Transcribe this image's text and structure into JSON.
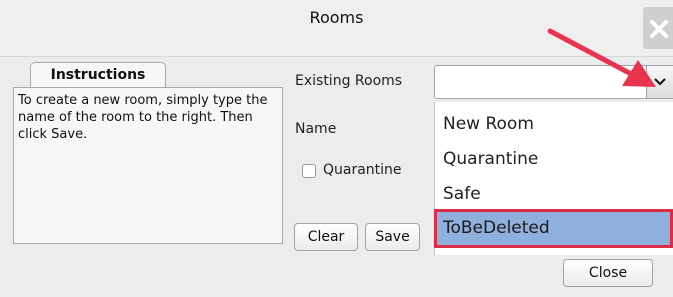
{
  "window": {
    "title": "Rooms"
  },
  "instructions": {
    "tab_label": "Instructions",
    "text": "To create a new room, simply type the name of the room to the right. Then click Save."
  },
  "form": {
    "existing_rooms_label": "Existing Rooms",
    "existing_rooms_value": "",
    "name_label": "Name",
    "quarantine_label": "Quarantine",
    "quarantine_checked": false
  },
  "buttons": {
    "clear": "Clear",
    "save": "Save",
    "close": "Close"
  },
  "dropdown": {
    "options": [
      "New Room",
      "Quarantine",
      "Safe",
      "ToBeDeleted"
    ],
    "selected_index": 3
  },
  "annotations": {
    "arrow_color": "#e8344f",
    "highlight_color": "#d92d48",
    "selected_bg": "#8fb0dc"
  },
  "icons": {
    "close": "close-icon",
    "dropdown": "chevron-down-icon",
    "annotation": "arrow-icon"
  }
}
